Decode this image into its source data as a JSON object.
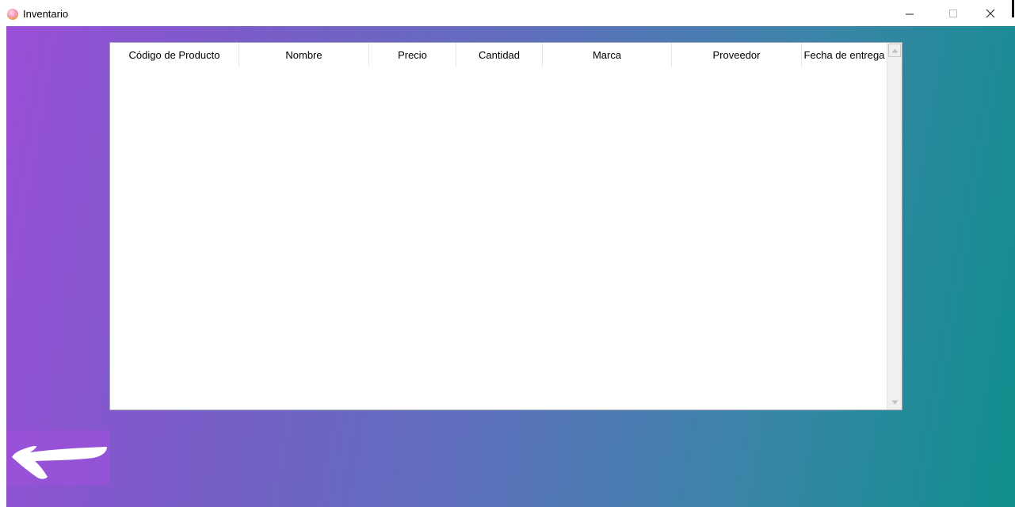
{
  "window": {
    "title": "Inventario",
    "icon": "app-donut-icon",
    "controls": {
      "minimize_icon": "minimize-icon",
      "maximize_icon": "maximize-icon",
      "close_icon": "close-icon"
    }
  },
  "colors": {
    "gradient_start": "#9a4fd8",
    "gradient_mid": "#5f6fbd",
    "gradient_end": "#0f8e8c",
    "table_background": "#ffffff"
  },
  "table": {
    "columns": [
      "Código de Producto",
      "Nombre",
      "Precio",
      "Cantidad",
      "Marca",
      "Proveedor",
      "Fecha de entrega"
    ],
    "rows": []
  },
  "back_button": {
    "icon": "back-arrow-icon"
  }
}
